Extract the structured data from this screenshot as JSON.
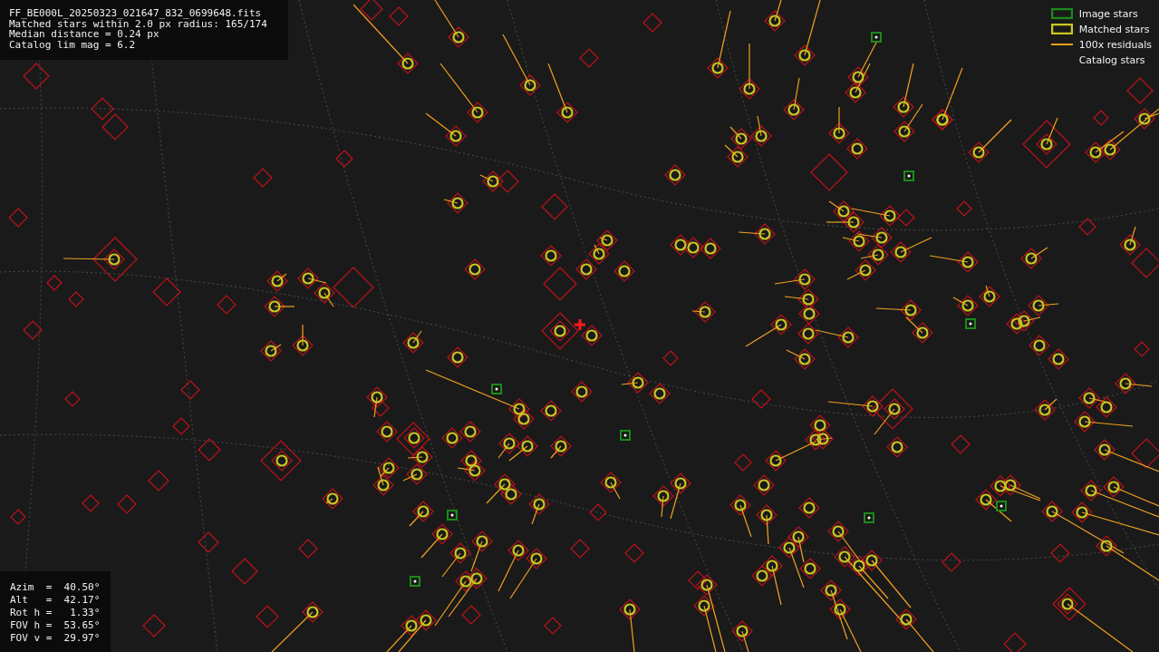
{
  "info_lines": [
    "FF_BE000L_20250323_021647_832_0699648.fits",
    "Matched stars within 2.0 px radius: 165/174",
    "Median distance = 0.24 px",
    "Catalog lim mag = 6.2"
  ],
  "legend": [
    {
      "kind": "image",
      "label": "Image stars"
    },
    {
      "kind": "matched",
      "label": "Matched stars"
    },
    {
      "kind": "residual",
      "label": "100x residuals"
    },
    {
      "kind": "catalog",
      "label": "Catalog stars"
    }
  ],
  "pointing": [
    "Azim  =  40.50°",
    "Alt   =  42.17°",
    "Rot h =   1.33°",
    "FOV h =  53.65°",
    "FOV v =  29.97°"
  ]
}
